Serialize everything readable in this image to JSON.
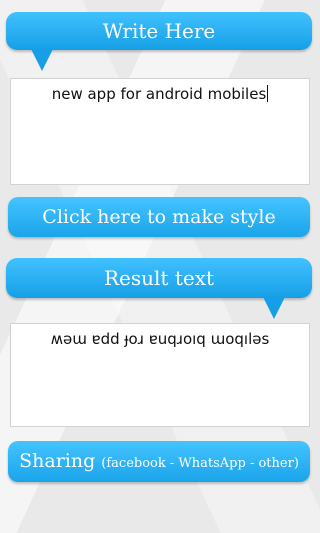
{
  "header_input": {
    "title": "Write Here"
  },
  "input": {
    "value": "new app for android mobiles"
  },
  "make_style_button": {
    "label": "Click here to make style"
  },
  "header_result": {
    "title": "Result text"
  },
  "output": {
    "value": "ʍǝɯ ɐdd ɟoɹ ɐuqɹoıq ɯoqılǝs"
  },
  "sharing_button": {
    "label": "Sharing",
    "platforms": "(facebook - WhatsApp - other)"
  },
  "colors": {
    "accent": "#1aa4ea",
    "accent_light": "#45c4ff",
    "background": "#e9e9e9"
  }
}
